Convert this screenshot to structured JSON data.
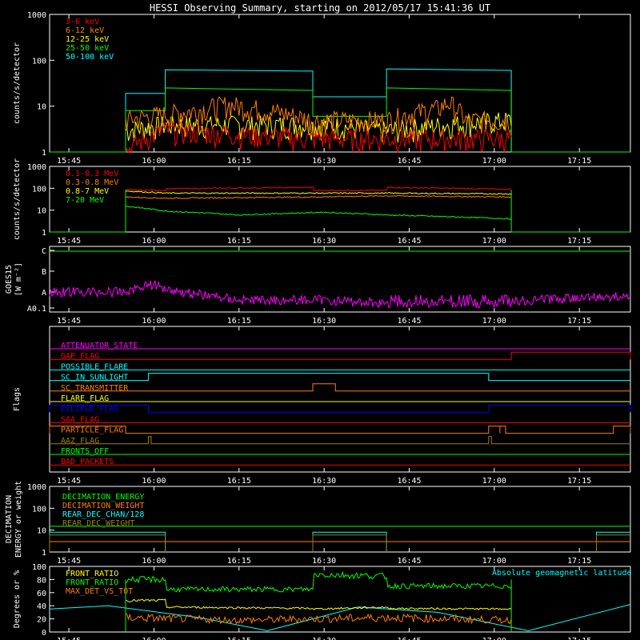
{
  "title": "HESSI Observing Summary, starting on 2012/05/17 15:41:36 UT",
  "time_ticks": [
    "15:45",
    "16:00",
    "16:15",
    "16:30",
    "16:45",
    "17:00",
    "17:15"
  ],
  "colors": {
    "bg": "#000000",
    "axes": "#ffffff",
    "red": "#ff0000",
    "orange": "#ff7f00",
    "yellow": "#ffff00",
    "green": "#00ff00",
    "cyan": "#00ffff",
    "magenta": "#ff00ff",
    "blue": "#0000ff",
    "olive": "#a08000",
    "lightblue": "#7fb0ff"
  },
  "chart_data": [
    {
      "id": "panel1",
      "type": "line",
      "ylabel": "counts/s/detector",
      "y_scale": "log",
      "ylim": [
        1,
        1000
      ],
      "y_tick_labels": [
        "1",
        "10",
        "100",
        "1000"
      ],
      "xlim": [
        "15:41:36",
        "17:24"
      ],
      "legend": [
        {
          "name": "3-6 keV",
          "color": "#ff0000"
        },
        {
          "name": "6-12 keV",
          "color": "#ff7f00"
        },
        {
          "name": "12-25 keV",
          "color": "#ffff00"
        },
        {
          "name": "25-50 keV",
          "color": "#00ff00"
        },
        {
          "name": "50-100 keV",
          "color": "#00ffff"
        }
      ],
      "series": [
        {
          "name": "50-100 keV",
          "color": "#00ffff",
          "x": [
            "15:41:36",
            "15:55",
            "15:55",
            "16:02",
            "16:02",
            "16:28",
            "16:28",
            "16:41",
            "16:41",
            "17:03",
            "17:03",
            "17:24"
          ],
          "y": [
            1,
            1,
            19,
            19,
            62,
            58,
            16,
            16,
            65,
            60,
            1,
            1
          ]
        },
        {
          "name": "25-50 keV",
          "color": "#00ff00",
          "x": [
            "15:41:36",
            "15:55",
            "15:55",
            "16:02",
            "16:02",
            "16:28",
            "16:28",
            "16:41",
            "16:41",
            "17:03",
            "17:03",
            "17:24"
          ],
          "y": [
            1,
            1,
            8,
            8,
            25,
            22,
            6,
            6,
            25,
            22,
            1,
            1
          ]
        },
        {
          "name": "12-25 keV",
          "color": "#ffff00",
          "x": [
            "15:55",
            "16:02",
            "16:28",
            "16:41",
            "16:52",
            "17:03"
          ],
          "y": [
            3,
            4,
            4,
            3,
            4,
            5
          ]
        },
        {
          "name": "6-12 keV",
          "color": "#ff7f00",
          "x": [
            "15:55",
            "16:07",
            "16:13",
            "16:28",
            "16:41",
            "16:50",
            "16:52",
            "16:55",
            "17:03"
          ],
          "y": [
            5,
            8,
            11,
            5,
            5,
            9,
            12,
            5,
            5
          ]
        },
        {
          "name": "3-6 keV",
          "color": "#ff0000",
          "x": [
            "15:55",
            "16:02",
            "16:28",
            "16:41",
            "17:03"
          ],
          "y": [
            1,
            3,
            2,
            2,
            2
          ]
        }
      ]
    },
    {
      "id": "panel2",
      "type": "line",
      "ylabel": "counts/s/detector",
      "y_scale": "log",
      "ylim": [
        1,
        1000
      ],
      "y_tick_labels": [
        "1",
        "10",
        "100",
        "1000"
      ],
      "legend": [
        {
          "name": "0.1-0.3 MeV",
          "color": "#ff0000"
        },
        {
          "name": "0.3-0.8 MeV",
          "color": "#ff7f00"
        },
        {
          "name": "0.8-7 MeV",
          "color": "#ffff00"
        },
        {
          "name": "7-20 MeV",
          "color": "#00ff00"
        }
      ],
      "series": [
        {
          "name": "0.1-0.3 MeV",
          "color": "#ff0000",
          "x": [
            "15:55",
            "16:02",
            "16:02",
            "16:28",
            "16:28",
            "16:41",
            "16:41",
            "17:03"
          ],
          "y": [
            85,
            80,
            95,
            110,
            80,
            80,
            110,
            90
          ]
        },
        {
          "name": "0.3-0.8 MeV",
          "color": "#ff7f00",
          "x": [
            "15:55",
            "16:02",
            "16:28",
            "16:41",
            "17:03"
          ],
          "y": [
            40,
            35,
            40,
            45,
            40
          ]
        },
        {
          "name": "0.8-7 MeV",
          "color": "#ffff00",
          "x": [
            "15:55",
            "16:02",
            "16:28",
            "16:41",
            "17:03"
          ],
          "y": [
            75,
            60,
            60,
            60,
            55
          ]
        },
        {
          "name": "7-20 MeV",
          "color": "#00ff00",
          "x": [
            "15:55",
            "16:02",
            "16:15",
            "16:30",
            "16:41",
            "17:03"
          ],
          "y": [
            15,
            9,
            6,
            8,
            6,
            4
          ]
        }
      ]
    },
    {
      "id": "panel3",
      "type": "line",
      "ylabel": "GOES15 [W m⁻²]",
      "y_scale": "log",
      "y_tick_labels": [
        "A0.1",
        "A",
        "B",
        "C"
      ],
      "series": [
        {
          "name": "GOES long",
          "color": "#00ff00",
          "x": [
            "15:41:36",
            "17:24"
          ],
          "y": [
            "C",
            "C"
          ]
        },
        {
          "name": "GOES short",
          "color": "#ff00ff",
          "x": [
            "15:41:36",
            "15:55",
            "15:59",
            "16:05",
            "16:15",
            "16:30",
            "16:41",
            "16:45",
            "17:00",
            "17:18",
            "17:24"
          ],
          "y": [
            "A",
            "A",
            "A+",
            "A",
            "A-",
            "A-",
            "A0.1",
            "A0.1",
            "A0.1",
            "A0.1+",
            "A0.1+"
          ]
        }
      ]
    },
    {
      "id": "panel4",
      "type": "line",
      "ylabel": "Flags",
      "flags": [
        {
          "name": "ATTENUATOR_STATE",
          "color": "#ff00ff",
          "on": []
        },
        {
          "name": "GAP_FLAG",
          "color": "#ff0000",
          "on": [
            [
              "17:03",
              "17:24"
            ]
          ]
        },
        {
          "name": "POSSIBLE_FLARE",
          "color": "#00ffff",
          "on": []
        },
        {
          "name": "SC_IN_SUNLIGHT",
          "color": "#00ffff",
          "on": [
            [
              "15:59",
              "16:59"
            ]
          ]
        },
        {
          "name": "SC_TRANSMITTER",
          "color": "#ff7f00",
          "on": [
            [
              "16:28",
              "16:32"
            ]
          ]
        },
        {
          "name": "FLARE_FLAG",
          "color": "#ffff00",
          "on": []
        },
        {
          "name": "ECLIPSE_FLAG",
          "color": "#0000ff",
          "on": [
            [
              "15:41:36",
              "15:59"
            ],
            [
              "16:59",
              "17:24"
            ]
          ]
        },
        {
          "name": "SAA_FLAG",
          "color": "#ff0000",
          "on": []
        },
        {
          "name": "PARTICLE_FLAG",
          "color": "#ff7f00",
          "on": [
            [
              "15:41:36",
              "15:55"
            ],
            [
              "16:59",
              "17:01"
            ],
            [
              "17:01",
              "17:02"
            ],
            [
              "17:21",
              "17:24"
            ]
          ]
        },
        {
          "name": "AAZ_FLAG",
          "color": "#a08000",
          "on": [
            [
              "15:59",
              "15:59:30"
            ],
            [
              "16:59",
              "16:59:30"
            ]
          ]
        },
        {
          "name": "FRONTS_OFF",
          "color": "#00ff00",
          "on": []
        },
        {
          "name": "BAD_PACKETS",
          "color": "#ff0000",
          "on": []
        }
      ]
    },
    {
      "id": "panel5",
      "type": "line",
      "ylabel": "DECIMATION ENERGY or weight",
      "y_scale": "log",
      "ylim": [
        1,
        1000
      ],
      "y_tick_labels": [
        "1",
        "10",
        "100",
        "1000"
      ],
      "legend": [
        {
          "name": "DECIMATION_ENERGY",
          "color": "#00ff00"
        },
        {
          "name": "DECIMATION_WEIGHT",
          "color": "#ff7f00"
        },
        {
          "name": "REAR_DEC_CHAN/128",
          "color": "#00ffff"
        },
        {
          "name": "REAR_DEC_WEIGHT",
          "color": "#a08000"
        }
      ],
      "series": [
        {
          "name": "DECIMATION_ENERGY",
          "color": "#00ff00",
          "x": [
            "15:41:36",
            "17:24"
          ],
          "y": [
            15,
            15
          ]
        },
        {
          "name": "DECIMATION_WEIGHT",
          "color": "#ff7f00",
          "x": [
            "15:41:36",
            "17:24"
          ],
          "y": [
            3,
            3
          ]
        },
        {
          "name": "REAR_DEC_CHAN/128",
          "color": "#00ffff",
          "segments": [
            [
              [
                "15:41:36",
                1
              ],
              [
                "15:41:36",
                8
              ],
              [
                "16:02",
                8
              ],
              [
                "16:02",
                1
              ]
            ],
            [
              [
                "16:28",
                1
              ],
              [
                "16:28",
                8
              ],
              [
                "16:41",
                8
              ],
              [
                "16:41",
                1
              ]
            ],
            [
              [
                "17:18",
                1
              ],
              [
                "17:18",
                8
              ],
              [
                "17:24",
                8
              ]
            ]
          ]
        },
        {
          "name": "REAR_DEC_WEIGHT",
          "color": "#a08000",
          "segments": [
            [
              [
                "15:41:36",
                1
              ],
              [
                "15:41:36",
                6
              ],
              [
                "16:02",
                6
              ],
              [
                "16:02",
                1
              ]
            ],
            [
              [
                "16:28",
                1
              ],
              [
                "16:28",
                6
              ],
              [
                "16:41",
                6
              ],
              [
                "16:41",
                1
              ]
            ],
            [
              [
                "17:18",
                1
              ],
              [
                "17:18",
                6
              ],
              [
                "17:24",
                6
              ]
            ]
          ]
        }
      ]
    },
    {
      "id": "panel6",
      "type": "line",
      "ylabel": "Degrees or %",
      "ylim": [
        0,
        100
      ],
      "y_tick_labels": [
        "0",
        "20",
        "40",
        "60",
        "80",
        "100"
      ],
      "legend": [
        {
          "name": "FRONT_RATIO",
          "color": "#ffff00"
        },
        {
          "name": "FRONT_RATIO",
          "color": "#00ff00"
        },
        {
          "name": "MAX_DET_VS_TOT",
          "color": "#ff7f00"
        }
      ],
      "annotation": {
        "text": "Absolute geomagnetic latitude",
        "color": "#00ffff"
      },
      "series": [
        {
          "name": "FRONT_RATIO (green)",
          "color": "#00ff00",
          "x": [
            "15:55",
            "16:02",
            "16:02",
            "16:28",
            "16:28",
            "16:41",
            "16:41",
            "17:03"
          ],
          "y": [
            80,
            80,
            65,
            65,
            88,
            85,
            70,
            70
          ]
        },
        {
          "name": "FRONT_RATIO (yellow)",
          "color": "#ffff00",
          "x": [
            "15:55",
            "16:02",
            "16:02",
            "16:28",
            "16:28",
            "16:41",
            "16:41",
            "17:03"
          ],
          "y": [
            48,
            48,
            38,
            36,
            35,
            38,
            36,
            35
          ]
        },
        {
          "name": "MAX_DET_VS_TOT",
          "color": "#ff7f00",
          "x": [
            "15:55",
            "16:15",
            "16:41",
            "17:03"
          ],
          "y": [
            22,
            18,
            22,
            18
          ]
        },
        {
          "name": "Absolute geomagnetic latitude",
          "color": "#00ffff",
          "x": [
            "15:41:36",
            "15:52",
            "16:08",
            "16:20",
            "16:36",
            "16:50",
            "17:06",
            "17:24"
          ],
          "y": [
            35,
            40,
            22,
            2,
            38,
            30,
            2,
            42
          ]
        }
      ]
    }
  ]
}
